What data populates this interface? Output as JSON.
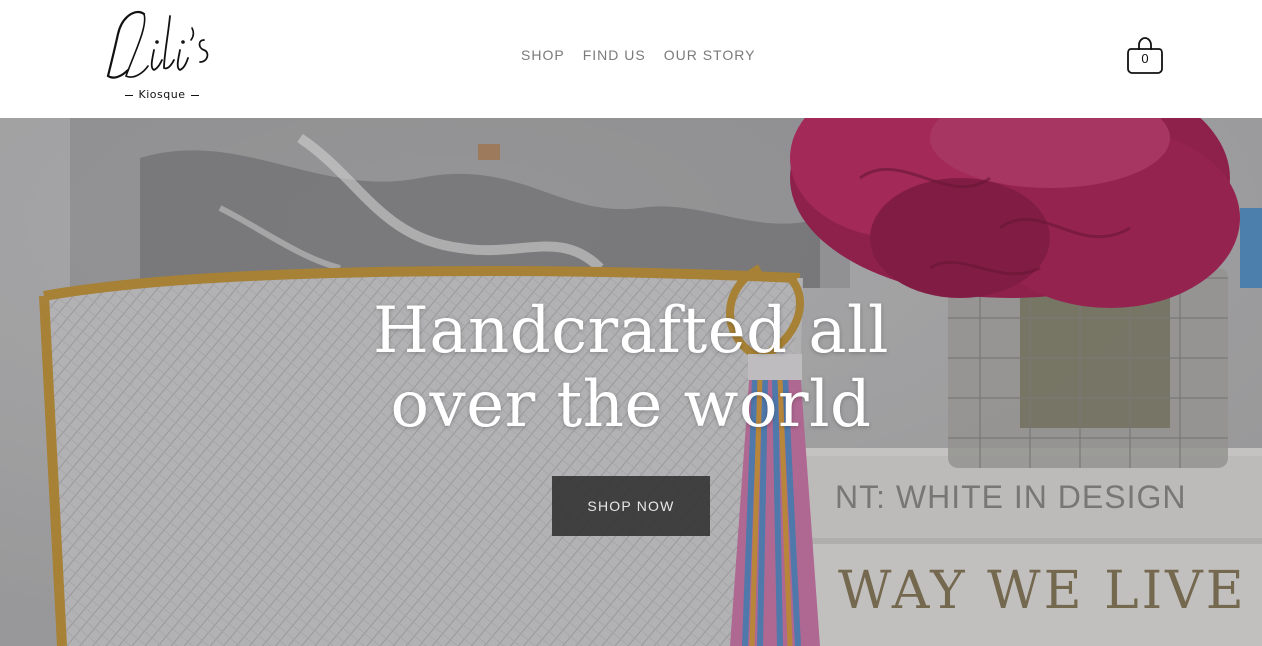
{
  "brand": {
    "logo_script": "Lili's",
    "logo_sub": "Kiosque"
  },
  "nav": {
    "items": [
      {
        "label": "SHOP"
      },
      {
        "label": "FIND US"
      },
      {
        "label": "OUR STORY"
      }
    ]
  },
  "cart": {
    "count": "0"
  },
  "hero": {
    "title_line1": "Handcrafted all",
    "title_line2": "over the world",
    "button_label": "SHOP NOW",
    "book1_text": "NT: WHITE IN DESIGN",
    "book2_text": "WAY WE LIVE"
  },
  "colors": {
    "nav_text": "#7a7a7a",
    "button_bg": "#2d2d2d",
    "flower": "#b0245a",
    "clutch_trim": "#c99a3a"
  }
}
